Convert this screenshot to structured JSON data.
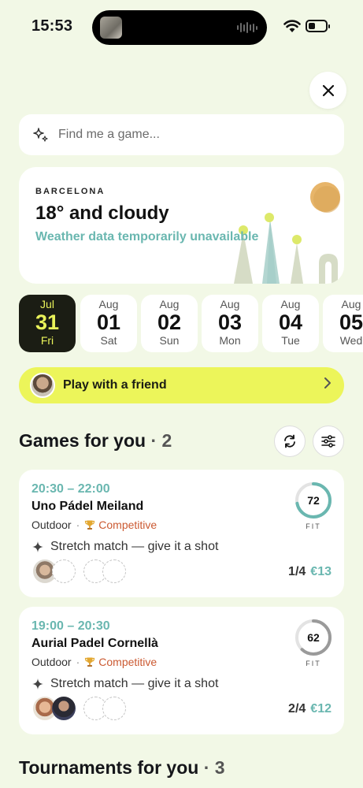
{
  "status": {
    "time": "15:53"
  },
  "search": {
    "placeholder": "Find me a game..."
  },
  "weather": {
    "city": "BARCELONA",
    "summary": "18° and cloudy",
    "note": "Weather data temporarily unavailable"
  },
  "dates": [
    {
      "month": "Jul",
      "day": "31",
      "weekday": "Fri",
      "selected": true
    },
    {
      "month": "Aug",
      "day": "01",
      "weekday": "Sat"
    },
    {
      "month": "Aug",
      "day": "02",
      "weekday": "Sun"
    },
    {
      "month": "Aug",
      "day": "03",
      "weekday": "Mon"
    },
    {
      "month": "Aug",
      "day": "04",
      "weekday": "Tue"
    },
    {
      "month": "Aug",
      "day": "05",
      "weekday": "Wed"
    }
  ],
  "friend": {
    "label": "Play with a friend"
  },
  "games": {
    "title": "Games for you",
    "count": "· 2",
    "items": [
      {
        "time": "20:30 – 22:00",
        "venue": "Uno Pádel Meiland",
        "setting": "Outdoor",
        "level": "Competitive",
        "note": "Stretch match — give it a shot",
        "fit": "72",
        "fit_fraction": 0.72,
        "fit_label": "FIT",
        "slots": "1/4",
        "price": "€13"
      },
      {
        "time": "19:00 – 20:30",
        "venue": "Aurial Padel Cornellà",
        "setting": "Outdoor",
        "level": "Competitive",
        "note": "Stretch match — give it a shot",
        "fit": "62",
        "fit_fraction": 0.62,
        "fit_label": "FIT",
        "slots": "2/4",
        "price": "€12"
      }
    ]
  },
  "tournaments": {
    "title": "Tournaments for you",
    "count": "· 3"
  },
  "colors": {
    "accent": "#ecf55a",
    "teal": "#6ab7b0",
    "competitive": "#cb5a32",
    "selected_date_bg": "#1b1d14"
  }
}
